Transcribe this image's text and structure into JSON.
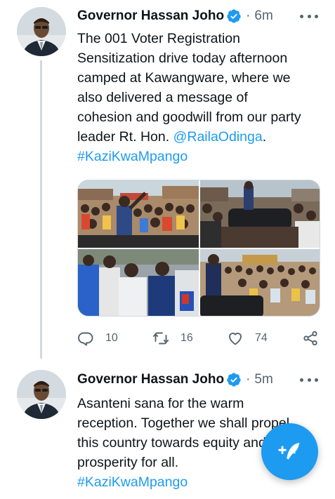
{
  "tweets": [
    {
      "author": "Governor Hassan Joho",
      "verified": true,
      "time": "6m",
      "text_lines": [
        "The 001 Voter Registration",
        "Sensitization drive today afternoon",
        "camped at Kawangware, where we",
        "also delivered a message of",
        "cohesion and goodwill from our party"
      ],
      "text_line6_prefix": "leader Rt. Hon. ",
      "mention": "@RailaOdinga",
      "text_line6_suffix": ".",
      "hashtag": "#KaziKwaMpango",
      "media_count": 4,
      "replies": "10",
      "retweets": "16",
      "likes": "74"
    },
    {
      "author": "Governor Hassan Joho",
      "verified": true,
      "time": "5m",
      "text_lines": [
        "Asanteni sana for the warm",
        "reception. Together we shall propel",
        "this country towards equity and",
        "prosperity for all."
      ],
      "hashtag": "#KaziKwaMpango"
    }
  ],
  "separator": "·",
  "icons": {
    "verified": "verified-badge-icon",
    "more": "more-options-icon",
    "reply": "reply-icon",
    "retweet": "retweet-icon",
    "like": "heart-icon",
    "share": "share-icon",
    "compose": "compose-tweet-icon"
  },
  "colors": {
    "accent": "#1d9bf0",
    "text": "#0f1419",
    "secondary": "#536471",
    "thread_line": "#cfd9de"
  }
}
